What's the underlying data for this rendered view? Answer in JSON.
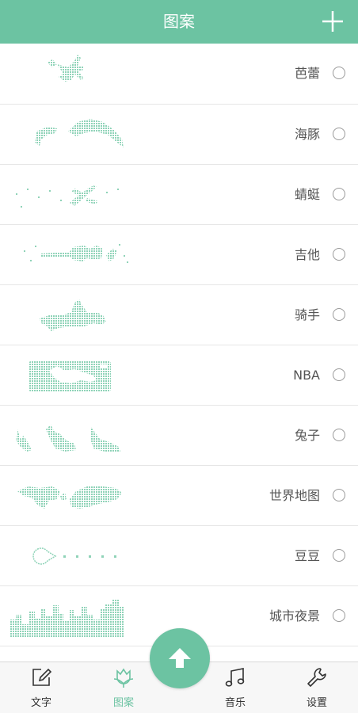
{
  "header": {
    "title": "图案",
    "add_icon": "plus-icon"
  },
  "patterns": [
    {
      "label": "芭蕾",
      "icon": "ballet-pattern"
    },
    {
      "label": "海豚",
      "icon": "dolphin-pattern"
    },
    {
      "label": "蜻蜓",
      "icon": "dragonfly-pattern"
    },
    {
      "label": "吉他",
      "icon": "guitar-pattern"
    },
    {
      "label": "骑手",
      "icon": "rider-pattern"
    },
    {
      "label": "NBA",
      "icon": "nba-pattern"
    },
    {
      "label": "兔子",
      "icon": "rabbit-pattern"
    },
    {
      "label": "世界地图",
      "icon": "world-map-pattern"
    },
    {
      "label": "豆豆",
      "icon": "pacman-pattern"
    },
    {
      "label": "城市夜景",
      "icon": "city-night-pattern"
    }
  ],
  "tabbar": {
    "tabs": [
      {
        "label": "文字",
        "icon": "edit-icon"
      },
      {
        "label": "图案",
        "icon": "tulip-icon"
      },
      {
        "label": "音乐",
        "icon": "music-note-icon"
      },
      {
        "label": "设置",
        "icon": "wrench-icon"
      }
    ],
    "active_index": 1,
    "upload_icon": "arrow-up-icon"
  },
  "colors": {
    "accent": "#6cc3a2",
    "pattern": "#8fd3b8",
    "text": "#555555",
    "divider": "#e6e6e6"
  }
}
